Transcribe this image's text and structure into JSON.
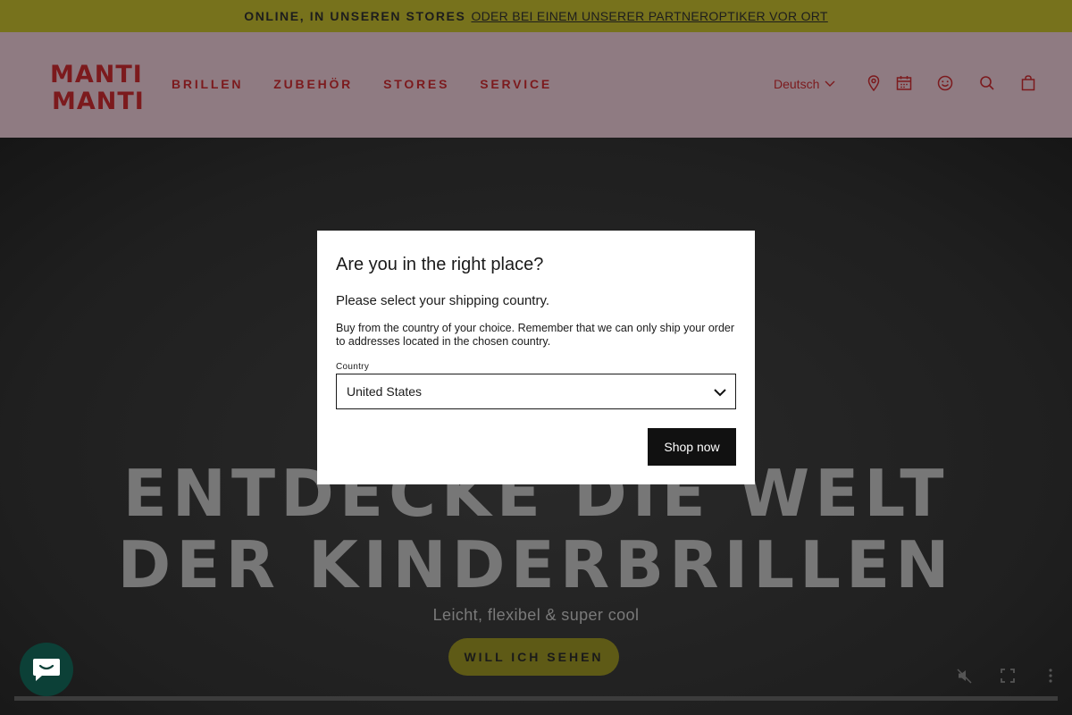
{
  "announcement": {
    "strong_text": "ONLINE, IN UNSEREN STORES",
    "link_text": "ODER BEI EINEM UNSERER PARTNEROPTIKER VOR ORT"
  },
  "header": {
    "logo_text": "MANTI MANTI",
    "nav": [
      "BRILLEN",
      "ZUBEHÖR",
      "STORES",
      "SERVICE"
    ],
    "language": "Deutsch",
    "icons": [
      "map-pin-icon",
      "calendar-icon",
      "account-icon",
      "search-icon",
      "bag-icon"
    ]
  },
  "hero": {
    "title": "ENTDECKE DIE WELT DER KINDERBRILLEN",
    "subtitle": "Leicht, flexibel & super cool",
    "cta": "WILL ICH SEHEN"
  },
  "modal": {
    "title": "Are you in the right place?",
    "subtitle": "Please select your shipping country.",
    "description": "Buy from the country of your choice. Remember that we can only ship your order to addresses located in the chosen country.",
    "country_label": "Country",
    "country_value": "United States",
    "button": "Shop now"
  },
  "colors": {
    "announcement_bg": "#77721c",
    "header_bg": "#8f7b82",
    "brand_red": "#7c1a1d",
    "chat_bg": "#0c4037"
  }
}
